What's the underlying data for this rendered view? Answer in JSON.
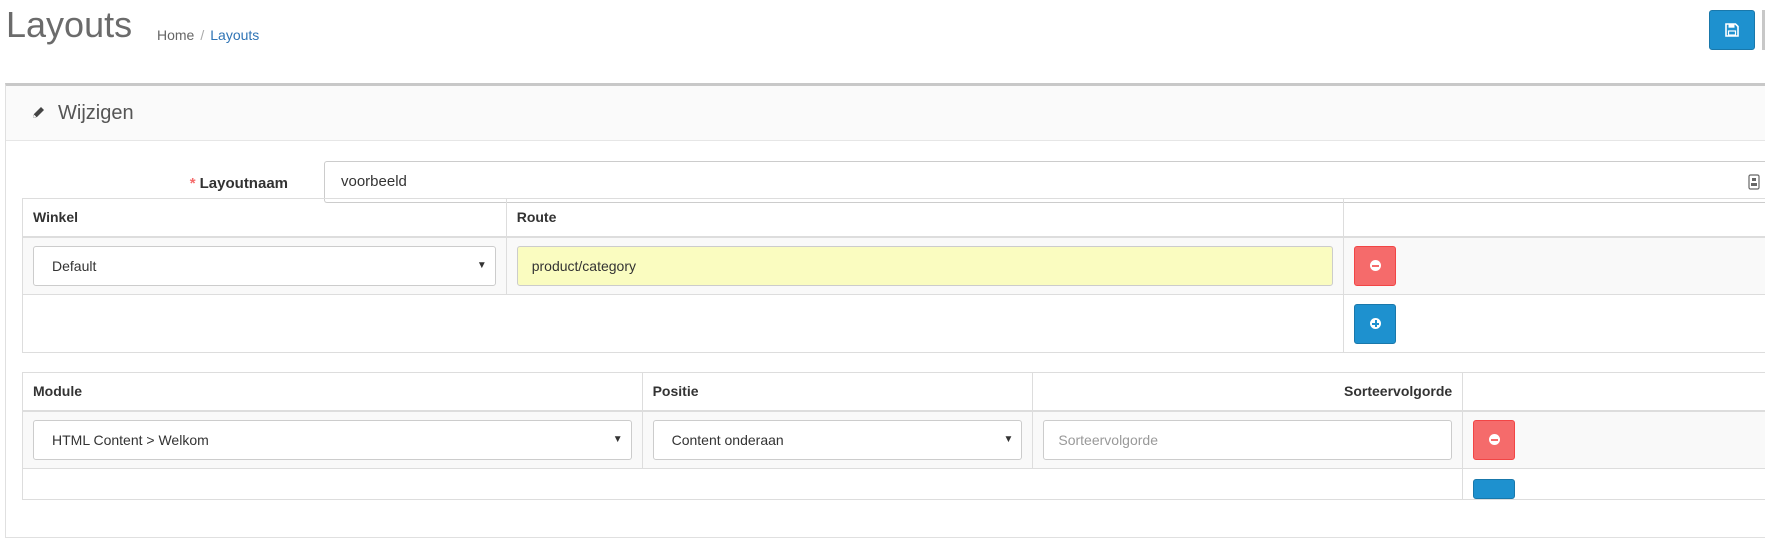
{
  "header": {
    "title": "Layouts",
    "breadcrumb": [
      "Home",
      "Layouts"
    ],
    "breadcrumb_separator": "/"
  },
  "panel": {
    "heading": "Wijzigen"
  },
  "form": {
    "required_marker": "*",
    "layout_name_label": "Layoutnaam",
    "layout_name_value": "voorbeeld"
  },
  "route_table": {
    "headers": [
      "Winkel",
      "Route",
      ""
    ],
    "rows": [
      {
        "store": "Default",
        "route": "product/category"
      }
    ]
  },
  "module_table": {
    "headers": [
      "Module",
      "Positie",
      "Sorteervolgorde",
      ""
    ],
    "rows": [
      {
        "module": "HTML Content > Welkom",
        "position": "Content onderaan",
        "sort_placeholder": "Sorteervolgorde"
      }
    ]
  },
  "colors": {
    "primary": "#1e91cf",
    "danger": "#f56b6b",
    "route_highlight": "#fafcc0"
  },
  "icons": {
    "save": "save-icon",
    "edit": "pencil-icon",
    "remove": "minus-circle-icon",
    "add": "plus-circle-icon",
    "dropdown": "caret-down-icon"
  }
}
